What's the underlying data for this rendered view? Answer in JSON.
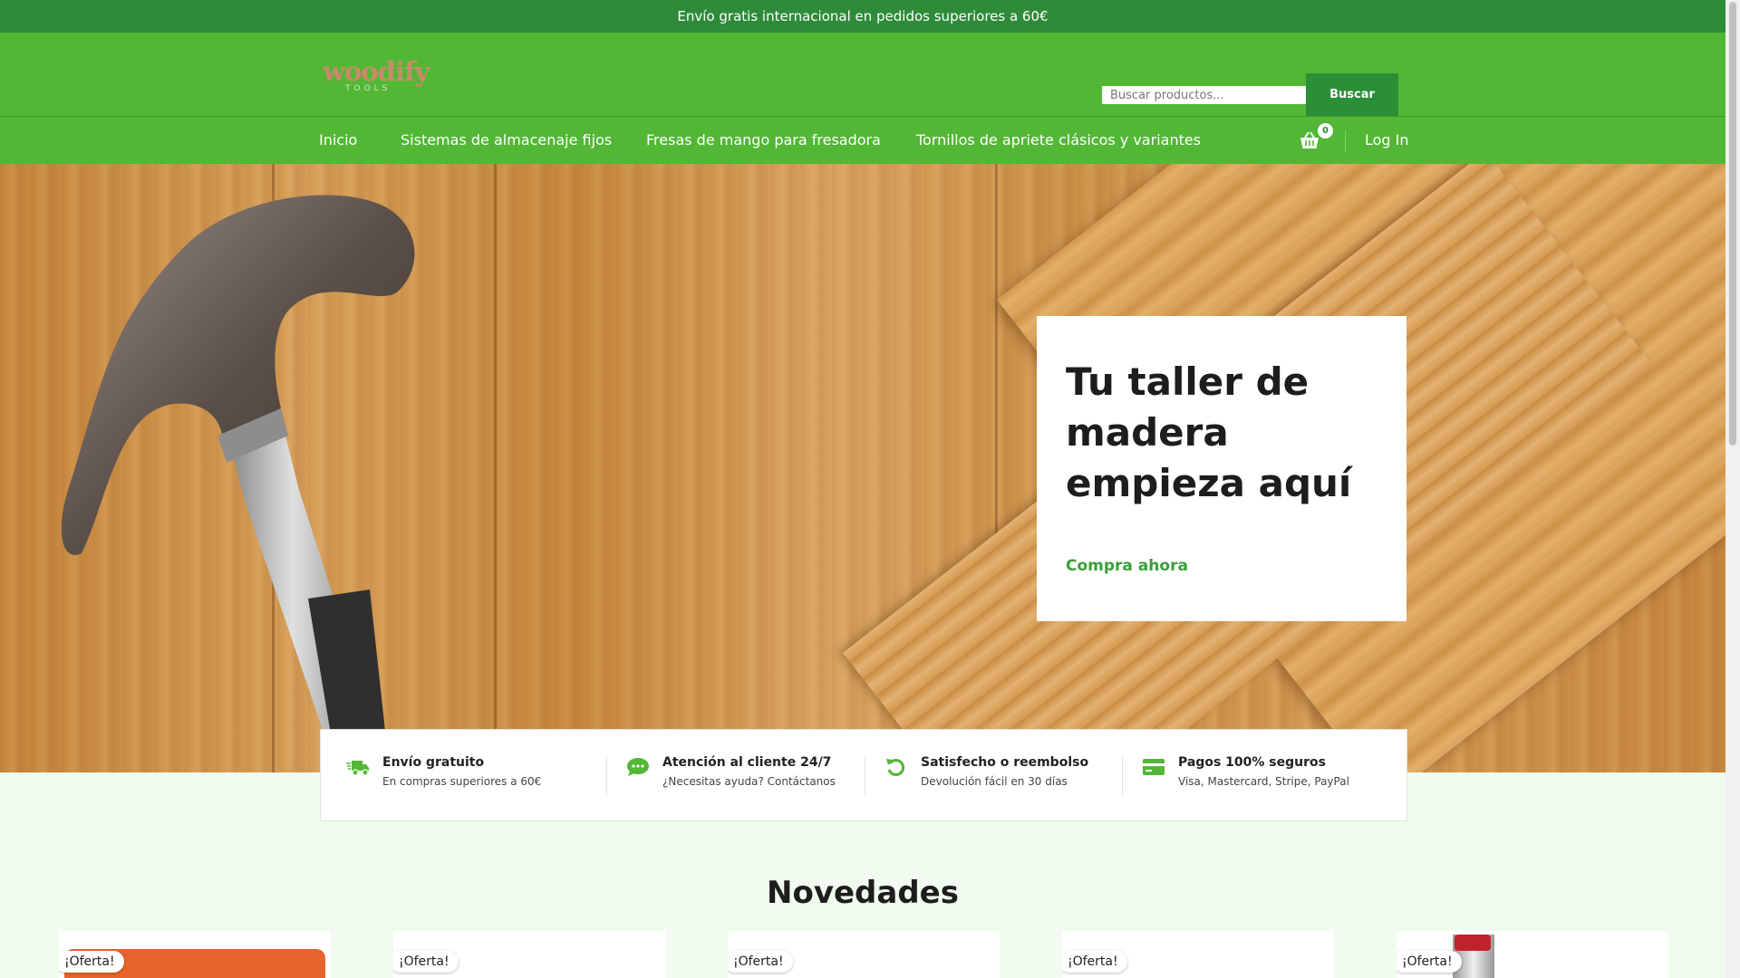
{
  "announcement": "Envío gratis internacional en pedidos superiores a 60€",
  "logo": {
    "name": "woodify",
    "tagline": "TOOLS"
  },
  "search": {
    "placeholder": "Buscar productos...",
    "button": "Buscar"
  },
  "nav": {
    "items": [
      {
        "label": "Inicio"
      },
      {
        "label": "Sistemas de almacenaje fijos"
      },
      {
        "label": "Fresas de mango para fresadora"
      },
      {
        "label": "Tornillos de apriete clásicos y variantes"
      }
    ],
    "cart_count": "0",
    "login": "Log In"
  },
  "hero": {
    "title": "Tu taller de madera empieza aquí",
    "cta": "Compra ahora"
  },
  "features": [
    {
      "icon": "truck-icon",
      "title": "Envío gratuito",
      "subtitle": "En compras superiores a 60€"
    },
    {
      "icon": "chat-icon",
      "title": "Atención al cliente 24/7",
      "subtitle": "¿Necesitas ayuda? Contáctanos"
    },
    {
      "icon": "refresh-icon",
      "title": "Satisfecho o reembolso",
      "subtitle": "Devolución fácil en 30 días"
    },
    {
      "icon": "credit-card-icon",
      "title": "Pagos 100% seguros",
      "subtitle": "Visa, Mastercard, Stripe, PayPal"
    }
  ],
  "section": {
    "title": "Novedades"
  },
  "products": [
    {
      "badge": "¡Oferta!"
    },
    {
      "badge": "¡Oferta!"
    },
    {
      "badge": "¡Oferta!"
    },
    {
      "badge": "¡Oferta!"
    },
    {
      "badge": "¡Oferta!"
    }
  ],
  "colors": {
    "brand_green": "#52b735",
    "dark_green": "#2e8b3a",
    "accent_text": "#3a9e3a"
  }
}
